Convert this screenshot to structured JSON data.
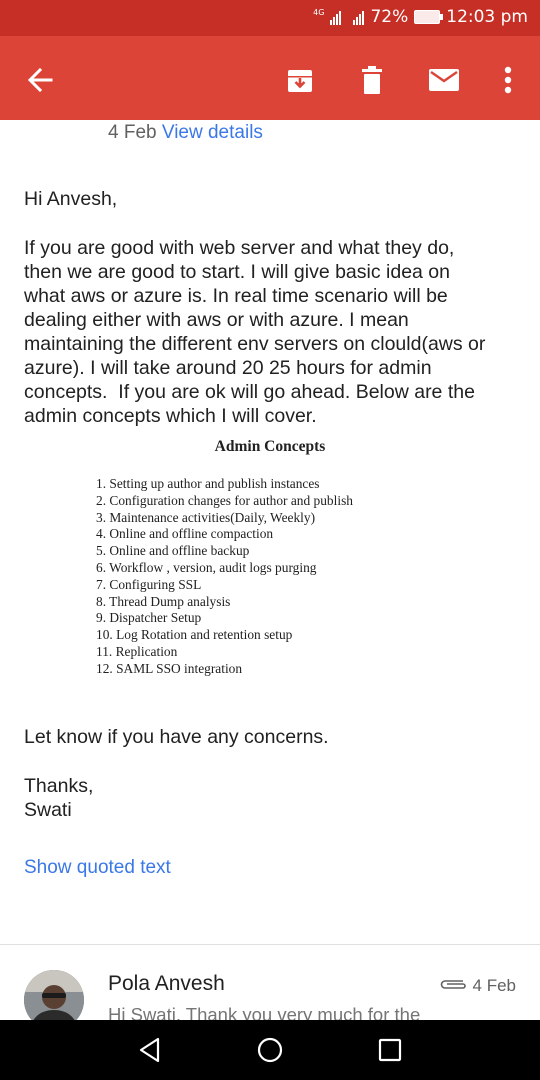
{
  "status_bar": {
    "network": "4G",
    "battery_percent": "72%",
    "time": "12:03 pm"
  },
  "app_bar": {
    "icons": [
      "back-arrow-icon",
      "archive-icon",
      "delete-icon",
      "mark-unread-icon",
      "more-vertical-icon"
    ],
    "color": "#db4437"
  },
  "message": {
    "date": "4 Feb",
    "view_details": "View details",
    "greeting": "Hi Anvesh,",
    "body_lines": [
      "If you are good with web server and what they do,",
      "then we are good to start. I will give basic idea on",
      "what aws or azure is. In real time scenario will be",
      "dealing either with aws or with azure. I mean",
      "maintaining the different env servers on clould(aws or",
      "azure). I will take around 20 25 hours for admin",
      "concepts.  If you are ok will go ahead. Below are the",
      "admin concepts which I will cover."
    ],
    "concepts_title": "Admin Concepts",
    "concepts": [
      "1. Setting up author and publish instances",
      "2. Configuration changes for author and publish",
      "3. Maintenance activities(Daily, Weekly)",
      "4. Online and offline compaction",
      "5. Online and offline backup",
      "6. Workflow , version, audit logs purging",
      "7. Configuring SSL",
      "8. Thread Dump analysis",
      "9. Dispatcher Setup",
      "10. Log Rotation and retention setup",
      "11. Replication",
      "12. SAML SSO integration"
    ],
    "closing": "Let know if you have any concerns.",
    "thanks": "Thanks,",
    "signature": "Swati",
    "show_quoted": "Show quoted text"
  },
  "reply": {
    "sender": "Pola Anvesh",
    "date": "4 Feb",
    "snippet": "Hi Swati, Thank you very much for the"
  },
  "nav_bar": {
    "icons": [
      "back-triangle-icon",
      "home-circle-icon",
      "recents-square-icon"
    ]
  }
}
